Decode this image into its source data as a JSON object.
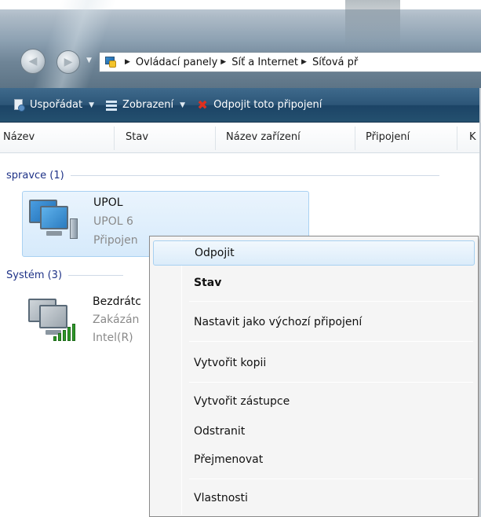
{
  "address_bar": {
    "crumbs": [
      "Ovládací panely",
      "Síť a Internet",
      "Síťová př"
    ]
  },
  "toolbar": {
    "organize_label": "Uspořádat",
    "views_label": "Zobrazení",
    "disconnect_label": "Odpojit toto připojení"
  },
  "columns": [
    "Název",
    "Stav",
    "Název zařízení",
    "Připojení",
    "K"
  ],
  "groups": [
    {
      "header": "spravce (1)",
      "items": [
        {
          "name": "UPOL",
          "line2": "UPOL 6",
          "line3": "Připojen"
        }
      ]
    },
    {
      "header": "Systém (3)",
      "items": [
        {
          "name": "Bezdrátc",
          "line2": "Zakázán",
          "line3": "Intel(R)"
        }
      ]
    }
  ],
  "context_menu": {
    "items": [
      {
        "label": "Odpojit",
        "state": "hover"
      },
      {
        "label": "Stav",
        "state": "default-bold"
      },
      {
        "label": "Nastavit jako výchozí připojení"
      },
      {
        "label": "Vytvořit kopii"
      },
      {
        "label": "Vytvořit zástupce"
      },
      {
        "label": "Odstranit"
      },
      {
        "label": "Přejmenovat"
      },
      {
        "label": "Vlastnosti"
      }
    ]
  },
  "icons": {
    "back": "back-arrow-icon",
    "forward": "forward-arrow-icon",
    "location": "control-panel-icon",
    "organize": "organize-icon",
    "views": "views-icon",
    "disconnect": "red-x-icon",
    "lan": "network-connection-icon",
    "wireless": "wireless-connection-icon"
  },
  "colors": {
    "toolbar_bg": "#24506f",
    "group_header": "#1e3287",
    "selection": "#d6eafb",
    "disconnect_red": "#e0301e"
  }
}
